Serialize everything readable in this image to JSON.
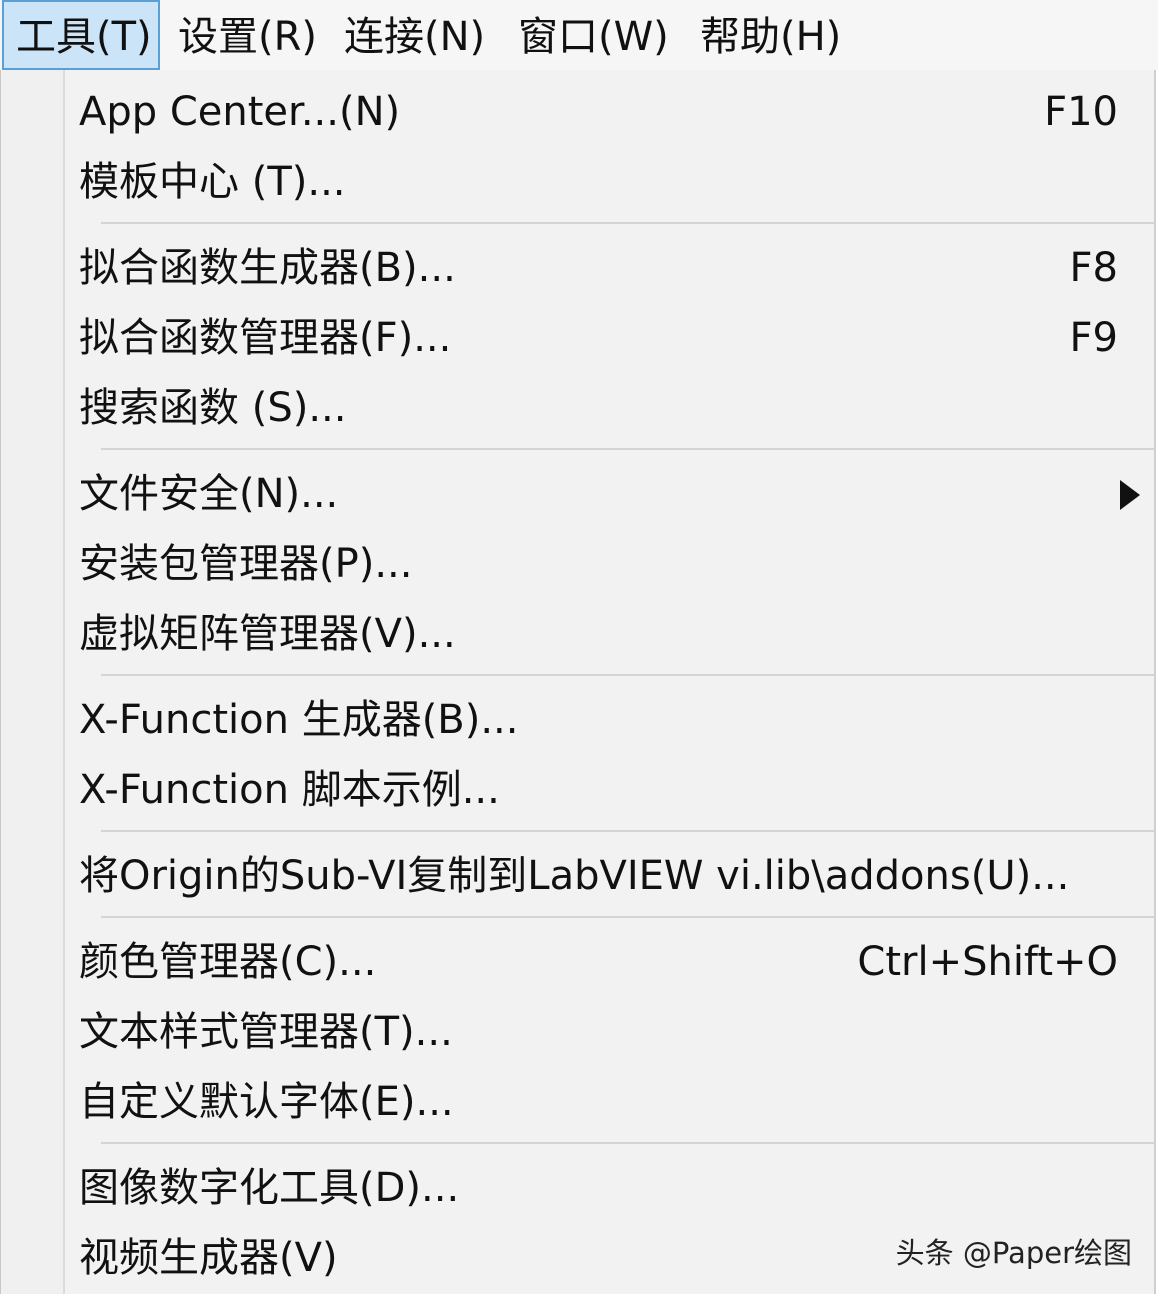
{
  "menubar": {
    "items": [
      {
        "label": "工具(T)"
      },
      {
        "label": "设置(R)"
      },
      {
        "label": "连接(N)"
      },
      {
        "label": "窗口(W)"
      },
      {
        "label": "帮助(H)"
      }
    ]
  },
  "menu": {
    "items": [
      {
        "label": "App Center...(N)",
        "shortcut": "F10"
      },
      {
        "label": "模板中心 (T)..."
      },
      {
        "label": "拟合函数生成器(B)...",
        "shortcut": "F8"
      },
      {
        "label": "拟合函数管理器(F)...",
        "shortcut": "F9"
      },
      {
        "label": "搜索函数 (S)..."
      },
      {
        "label": "文件安全(N)...",
        "icon": "submenu-arrow-icon"
      },
      {
        "label": "安装包管理器(P)..."
      },
      {
        "label": "虚拟矩阵管理器(V)..."
      },
      {
        "label": "X-Function 生成器(B)..."
      },
      {
        "label": "X-Function 脚本示例..."
      },
      {
        "label": "将Origin的Sub-VI复制到LabVIEW vi.lib\\addons(U)..."
      },
      {
        "label": "颜色管理器(C)...",
        "shortcut": "Ctrl+Shift+O"
      },
      {
        "label": "文本样式管理器(T)..."
      },
      {
        "label": "自定义默认字体(E)..."
      },
      {
        "label": "图像数字化工具(D)..."
      },
      {
        "label": "视频生成器(V)"
      }
    ]
  },
  "watermark": "头条 @Paper绘图",
  "colors": {
    "menubar_bg": "#f6f6f6",
    "active_bg": "#cce4f7",
    "active_border": "#5aa0d6",
    "menu_bg": "#f2f2f2",
    "separator": "#d4d4d4"
  }
}
